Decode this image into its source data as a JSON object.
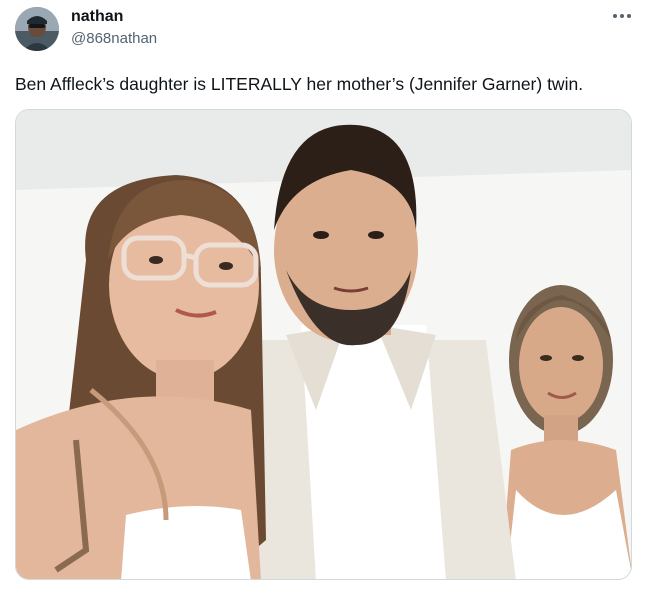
{
  "author": {
    "display_name": "nathan",
    "handle": "@868nathan",
    "avatar_icon": "avatar-photo"
  },
  "header": {
    "more_icon": "more-horizontal-icon"
  },
  "tweet": {
    "text": "Ben Affleck’s daughter is LITERALLY her mother’s (Jennifer Garner) twin."
  },
  "media": {
    "type": "photo",
    "colors": {
      "background": "#f3f4f2",
      "hair_dark": "#2a1e17",
      "hair_light": "#6b4a33",
      "skin": "#e2b89e",
      "suit": "#ece7df"
    }
  },
  "theme": {
    "text_primary": "#0f1419",
    "text_secondary": "#536471",
    "border": "#cfd9de"
  }
}
